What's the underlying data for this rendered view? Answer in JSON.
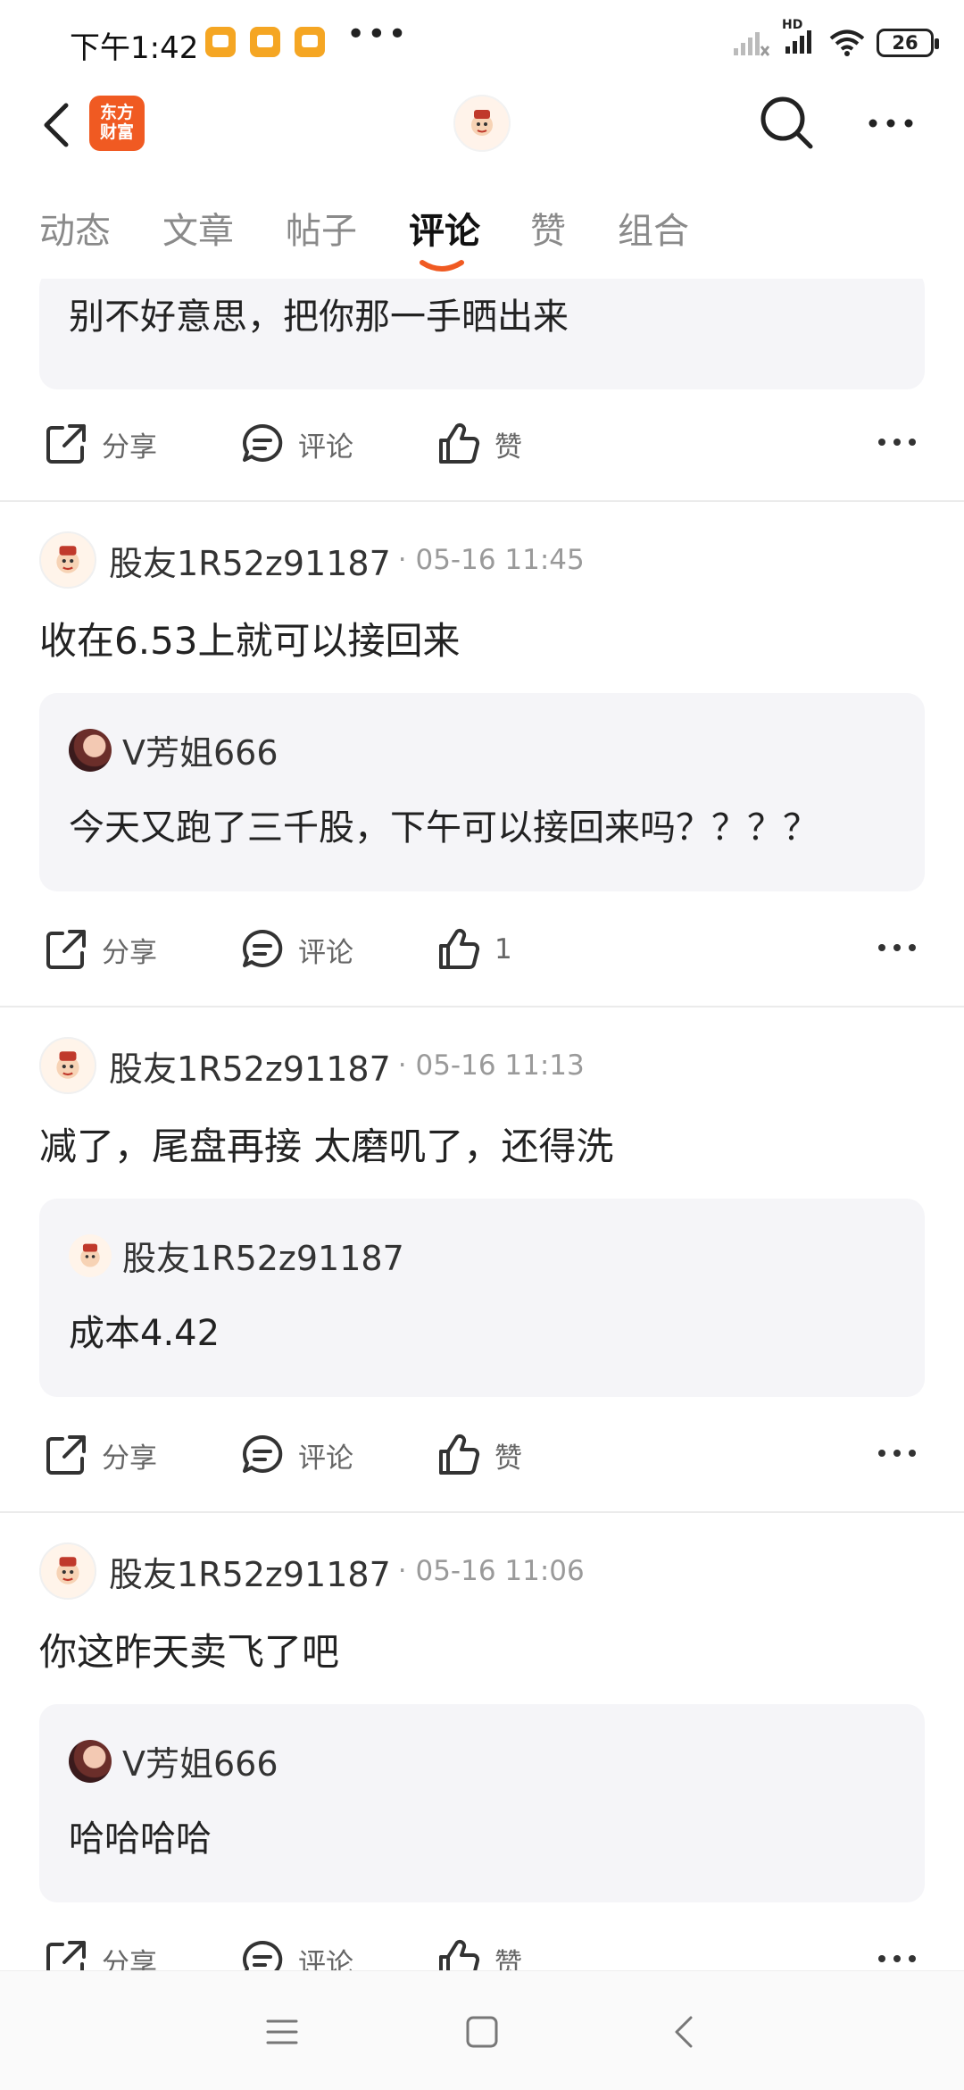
{
  "status_bar": {
    "time": "下午1:42",
    "more_dots": "•••",
    "battery": "26",
    "network": "HD"
  },
  "header": {
    "logo_text_line1": "东方",
    "logo_text_line2": "财富"
  },
  "tabs": [
    {
      "label": "动态",
      "active": false
    },
    {
      "label": "文章",
      "active": false
    },
    {
      "label": "帖子",
      "active": false
    },
    {
      "label": "评论",
      "active": true
    },
    {
      "label": "赞",
      "active": false
    },
    {
      "label": "组合",
      "active": false
    }
  ],
  "accent_color": "#f05a22",
  "posts": [
    {
      "quote": {
        "text": "别不好意思，把你那一手晒出来"
      },
      "actions": {
        "share": "分享",
        "comment": "评论",
        "like": "赞"
      }
    },
    {
      "user": "股友1R52z91187",
      "time": "· 05-16 11:45",
      "text": "收在6.53上就可以接回来",
      "quote": {
        "user": "V芳姐666",
        "text": "今天又跑了三千股，下午可以接回来吗？？？？"
      },
      "actions": {
        "share": "分享",
        "comment": "评论",
        "like": "1"
      }
    },
    {
      "user": "股友1R52z91187",
      "time": "· 05-16 11:13",
      "text": "减了，尾盘再接 太磨叽了，还得洗",
      "quote": {
        "user": "股友1R52z91187",
        "text": "成本4.42"
      },
      "actions": {
        "share": "分享",
        "comment": "评论",
        "like": "赞"
      }
    },
    {
      "user": "股友1R52z91187",
      "time": "· 05-16 11:06",
      "text": "你这昨天卖飞了吧",
      "quote": {
        "user": "V芳姐666",
        "text": "哈哈哈哈"
      },
      "actions": {
        "share": "分享",
        "comment": "评论",
        "like": "赞"
      }
    }
  ]
}
